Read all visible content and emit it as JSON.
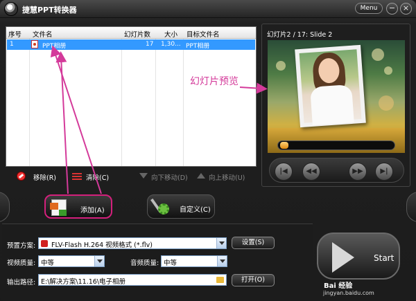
{
  "window": {
    "title": "捷慧PPT转换器",
    "menu_label": "Menu",
    "minimize_glyph": "−",
    "close_glyph": "×"
  },
  "file_list": {
    "columns": [
      "序号",
      "文件名",
      "幻灯片数",
      "大小",
      "目标文件名"
    ],
    "rows": [
      {
        "index": "1",
        "file_name": "PPT相册",
        "slides": "17",
        "size": "1,30...",
        "target_name": "PPT相册"
      }
    ]
  },
  "list_toolbar": {
    "remove_label": "移除(R)",
    "clear_label": "清除(C)",
    "move_down_label": "向下移动(D)",
    "move_up_label": "向上移动(U)"
  },
  "preview": {
    "title": "幻灯片2 / 17: Slide 2",
    "annotation": "幻灯片预览",
    "controls": {
      "first": "|◀",
      "rewind": "◀◀",
      "forward": "▶▶",
      "last": "▶|"
    }
  },
  "actions": {
    "add_label": "添加(A)",
    "custom_label": "自定义(C)"
  },
  "settings": {
    "preset_label": "预置方案:",
    "preset_value": "FLV-Flash H.264 视频格式 (*.flv)",
    "setup_button": "设置(S)",
    "video_quality_label": "视频质量:",
    "video_quality_value": "中等",
    "audio_quality_label": "音频质量:",
    "audio_quality_value": "中等",
    "output_path_label": "输出路径:",
    "output_path_value": "E:\\解决方案\\11.16\\电子相册",
    "open_button": "打开(O)"
  },
  "start": {
    "label": "Start"
  },
  "watermark": {
    "text": "Bai 经验",
    "sub": "jingyan.baidu.com"
  },
  "colors": {
    "accent": "#d4207c",
    "selection": "#3399ff",
    "annotation": "#d43a9a"
  }
}
